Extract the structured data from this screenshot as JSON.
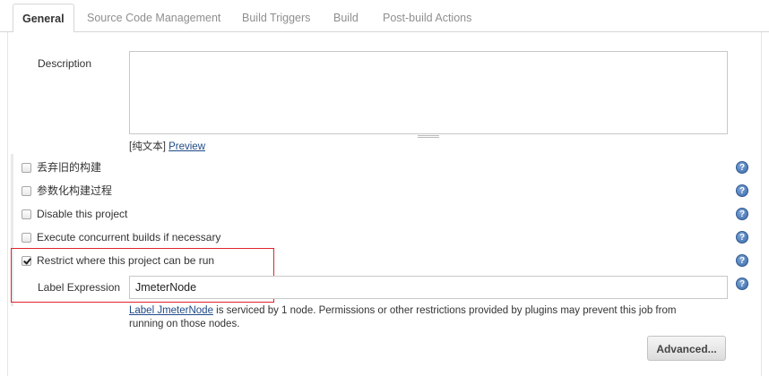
{
  "tabs": [
    {
      "label": "General",
      "active": true
    },
    {
      "label": "Source Code Management",
      "active": false
    },
    {
      "label": "Build Triggers",
      "active": false
    },
    {
      "label": "Build",
      "active": false
    },
    {
      "label": "Post-build Actions",
      "active": false
    }
  ],
  "description": {
    "label": "Description",
    "value": "",
    "format_text": "[纯文本]",
    "preview_link": "Preview"
  },
  "options": [
    {
      "label": "丢弃旧的构建",
      "checked": false
    },
    {
      "label": "参数化构建过程",
      "checked": false
    },
    {
      "label": "Disable this project",
      "checked": false
    },
    {
      "label": "Execute concurrent builds if necessary",
      "checked": false
    },
    {
      "label": "Restrict where this project can be run",
      "checked": true
    }
  ],
  "label_expression": {
    "label": "Label Expression",
    "value": "JmeterNode",
    "info_link": "Label JmeterNode",
    "info_text": " is serviced by 1 node. Permissions or other restrictions provided by plugins may prevent this job from running on those nodes."
  },
  "advanced_button": "Advanced...",
  "help_icon_glyph": "?",
  "colors": {
    "link": "#204a87",
    "highlight_border": "#e0242b",
    "help_icon": "#3b6aa8"
  }
}
